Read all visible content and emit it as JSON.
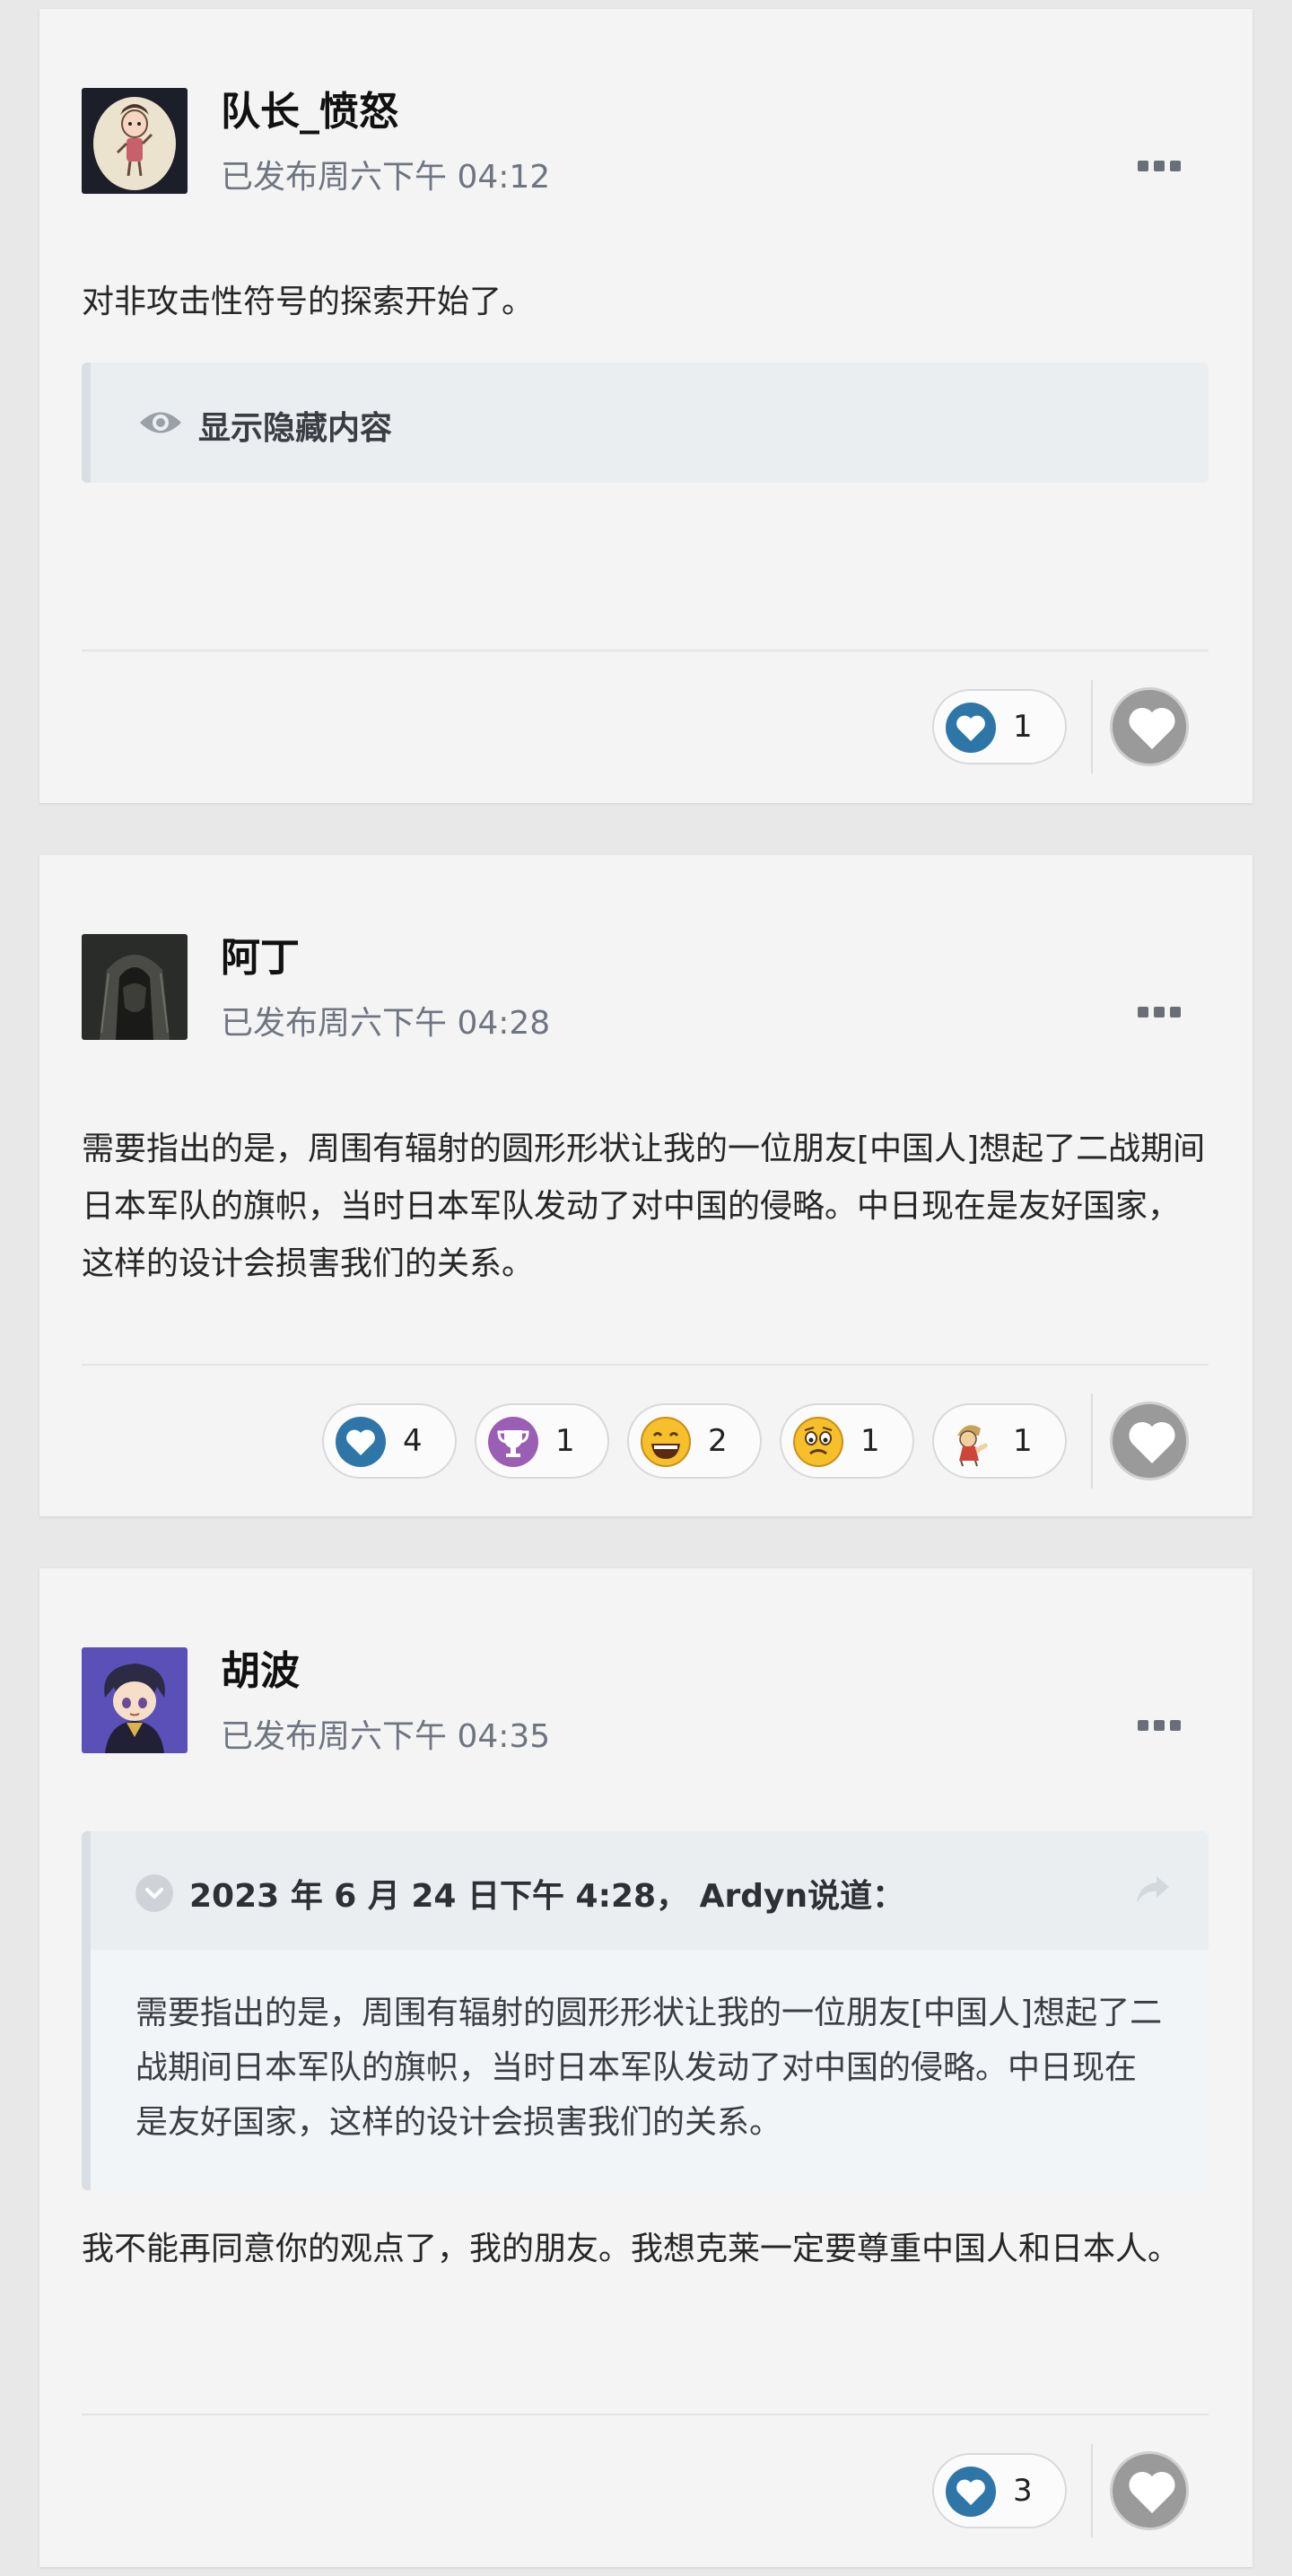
{
  "posts": [
    {
      "author": "队长_愤怒",
      "timestamp": "已发布周六下午 04:12",
      "body": "对非攻击性符号的探索开始了。",
      "hidden_content_label": "显示隐藏内容",
      "reactions": [
        {
          "icon": "heart-reaction-icon",
          "count": "1"
        }
      ]
    },
    {
      "author": "阿丁",
      "timestamp": "已发布周六下午 04:28",
      "body": "需要指出的是，周围有辐射的圆形形状让我的一位朋友[中国人]想起了二战期间日本军队的旗帜，当时日本军队发动了对中国的侵略。中日现在是友好国家，这样的设计会损害我们的关系。",
      "reactions": [
        {
          "icon": "heart-reaction-icon",
          "count": "4"
        },
        {
          "icon": "trophy-reaction-icon",
          "count": "1"
        },
        {
          "icon": "laughing-face-reaction-icon",
          "count": "2"
        },
        {
          "icon": "worried-face-reaction-icon",
          "count": "1"
        },
        {
          "icon": "character-reaction-icon",
          "count": "1"
        }
      ]
    },
    {
      "author": "胡波",
      "timestamp": "已发布周六下午 04:35",
      "quote": {
        "header": "2023 年 6 月 24 日下午 4:28， Ardyn说道：",
        "text": "需要指出的是，周围有辐射的圆形形状让我的一位朋友[中国人]想起了二战期间日本军队的旗帜，当时日本军队发动了对中国的侵略。中日现在是友好国家，这样的设计会损害我们的关系。"
      },
      "body": "我不能再同意你的观点了，我的朋友。我想克莱一定要尊重中国人和日本人。",
      "reactions": [
        {
          "icon": "heart-reaction-icon",
          "count": "3"
        }
      ]
    }
  ],
  "colors": {
    "heart_blue": "#2f76a8",
    "trophy_purple": "#9a5fb4",
    "emoji_yellow": "#f5c02c",
    "like_button_gray": "#9a9a9a"
  }
}
